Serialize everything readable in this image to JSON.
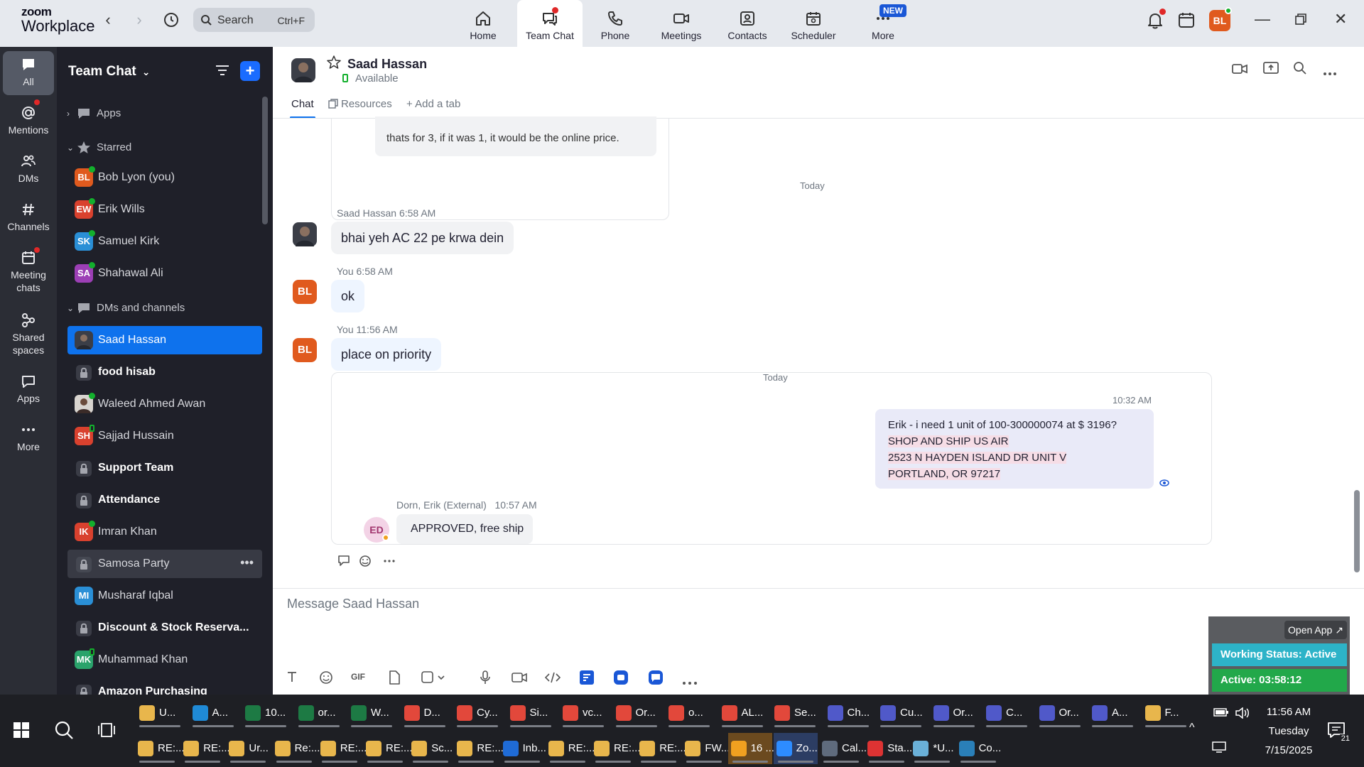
{
  "app": {
    "brand_top": "zoom",
    "brand_bottom": "Workplace",
    "search_label": "Search",
    "search_shortcut": "Ctrl+F",
    "nav_tabs": [
      {
        "label": "Home",
        "icon": "home-icon"
      },
      {
        "label": "Team Chat",
        "icon": "chat-icon",
        "active": true
      },
      {
        "label": "Phone",
        "icon": "phone-icon"
      },
      {
        "label": "Meetings",
        "icon": "video-icon"
      },
      {
        "label": "Contacts",
        "icon": "contacts-icon"
      },
      {
        "label": "Scheduler",
        "icon": "calendar-icon"
      },
      {
        "label": "More",
        "icon": "more-icon"
      }
    ],
    "new_badge": "NEW",
    "user_initials": "BL",
    "accent_color": "#0e72ed"
  },
  "rail": {
    "items": [
      {
        "label": "All",
        "icon": "chat-bubble-icon"
      },
      {
        "label": "Mentions",
        "icon": "at-icon"
      },
      {
        "label": "DMs",
        "icon": "people-icon"
      },
      {
        "label": "Channels",
        "icon": "hash-icon"
      },
      {
        "label": "Meeting\nchats",
        "icon": "calendar-chat-icon"
      },
      {
        "label": "Shared\nspaces",
        "icon": "shared-icon"
      },
      {
        "label": "Apps",
        "icon": "apps-icon"
      },
      {
        "label": "More",
        "icon": "ellipsis-icon"
      }
    ]
  },
  "sidebar": {
    "title": "Team Chat",
    "sections": {
      "apps": "Apps",
      "starred": "Starred",
      "dms": "DMs and channels"
    },
    "starred": [
      {
        "initials": "BL",
        "name": "Bob Lyon (you)",
        "color": "#e05a1e"
      },
      {
        "initials": "EW",
        "name": "Erik Wills",
        "color": "#d9412e"
      },
      {
        "initials": "SK",
        "name": "Samuel Kirk",
        "color": "#2a8fd6"
      },
      {
        "initials": "SA",
        "name": "Shahawal Ali",
        "color": "#9c3fb5"
      }
    ],
    "dms": [
      {
        "name": "Saad Hassan",
        "type": "photo",
        "selected": true
      },
      {
        "name": "food hisab",
        "type": "lock",
        "bold": true
      },
      {
        "name": "Waleed Ahmed Awan",
        "type": "photo"
      },
      {
        "initials": "SH",
        "name": "Sajjad Hussain",
        "color": "#d9412e"
      },
      {
        "name": "Support Team",
        "type": "lock",
        "bold": true
      },
      {
        "name": "Attendance",
        "type": "lock",
        "bold": true
      },
      {
        "initials": "IK",
        "name": "Imran Khan",
        "color": "#d9412e"
      },
      {
        "name": "Samosa Party",
        "type": "lock",
        "hover": true
      },
      {
        "initials": "MI",
        "name": "Musharaf Iqbal",
        "color": "#2a8fd6"
      },
      {
        "name": "Discount & Stock Reserva...",
        "type": "lock",
        "bold": true
      },
      {
        "initials": "MK",
        "name": "Muhammad Khan",
        "color": "#2aa36b"
      },
      {
        "name": "Amazon Purchasing",
        "type": "lock",
        "bold": true
      }
    ]
  },
  "chat": {
    "contact_name": "Saad Hassan",
    "status": "Available",
    "tabs": [
      "Chat",
      "Resources",
      "+ Add a tab"
    ],
    "quoted_text": "thats for 3, if it was 1, it would be the online price.",
    "day_sep_1": "Today",
    "day_sep_2": "Today",
    "messages": [
      {
        "sender": "Saad Hassan",
        "time": "6:58 AM",
        "text": "bhai yeh AC 22 pe krwa dein"
      },
      {
        "sender": "You",
        "time": "6:58 AM",
        "text": "ok"
      },
      {
        "sender": "You",
        "time": "11:56 AM",
        "text": "place on priority"
      }
    ],
    "thread": {
      "time": "10:32 AM",
      "lines": [
        "Erik  -  i need 1 unit of 100-300000074 at $ 3196?",
        "SHOP AND SHIP US AIR",
        "2523 N HAYDEN ISLAND DR UNIT V",
        "PORTLAND, OR 97217"
      ],
      "reply_initials": "ED",
      "reply_sender": "Dorn, Erik (External)",
      "reply_time": "10:57 AM",
      "reply_text": "APPROVED, free ship"
    },
    "composer_placeholder": "Message Saad Hassan"
  },
  "widget": {
    "open_app": "Open App ↗",
    "working_status": "Working Status: Active",
    "active_timer": "Active: 03:58:12"
  },
  "taskbar": {
    "row1": [
      {
        "label": "U...",
        "color": "#e8b64c"
      },
      {
        "label": "A...",
        "color": "#1f8ad6"
      },
      {
        "label": "10...",
        "color": "#1d7a44"
      },
      {
        "label": "or...",
        "color": "#1d7a44"
      },
      {
        "label": "W...",
        "color": "#1d7a44"
      },
      {
        "label": "D...",
        "color": "#e2483b"
      },
      {
        "label": "Cy...",
        "color": "#e2483b"
      },
      {
        "label": "Si...",
        "color": "#e2483b"
      },
      {
        "label": "vc...",
        "color": "#e2483b"
      },
      {
        "label": "Or...",
        "color": "#e2483b"
      },
      {
        "label": "o...",
        "color": "#e2483b"
      },
      {
        "label": "AL...",
        "color": "#e2483b"
      },
      {
        "label": "Se...",
        "color": "#e2483b"
      },
      {
        "label": "Ch...",
        "color": "#5059c9"
      },
      {
        "label": "Cu...",
        "color": "#5059c9"
      },
      {
        "label": "Or...",
        "color": "#5059c9"
      },
      {
        "label": "C...",
        "color": "#5059c9"
      },
      {
        "label": "Or...",
        "color": "#5059c9"
      },
      {
        "label": "A...",
        "color": "#5059c9"
      },
      {
        "label": "F...",
        "color": "#e8b64c"
      }
    ],
    "row2": [
      {
        "label": "RE:...",
        "color": "#e8b64c"
      },
      {
        "label": "RE:...",
        "color": "#e8b64c"
      },
      {
        "label": "Ur...",
        "color": "#e8b64c"
      },
      {
        "label": "Re:...",
        "color": "#e8b64c"
      },
      {
        "label": "RE:...",
        "color": "#e8b64c"
      },
      {
        "label": "RE:...",
        "color": "#e8b64c"
      },
      {
        "label": "Sc...",
        "color": "#e8b64c"
      },
      {
        "label": "RE:...",
        "color": "#e8b64c"
      },
      {
        "label": "Inb...",
        "color": "#1f6bd6"
      },
      {
        "label": "RE:...",
        "color": "#e8b64c"
      },
      {
        "label": "RE:...",
        "color": "#e8b64c"
      },
      {
        "label": "RE:...",
        "color": "#e8b64c"
      },
      {
        "label": "FW...",
        "color": "#e8b64c"
      },
      {
        "label": "16 ...",
        "color": "#f0a020"
      },
      {
        "label": "Zo...",
        "color": "#2d8cff"
      },
      {
        "label": "Cal...",
        "color": "#5f6b7d"
      },
      {
        "label": "Sta...",
        "color": "#d33"
      },
      {
        "label": "*U...",
        "color": "#6ab0d8"
      },
      {
        "label": "Co...",
        "color": "#2a7fb8"
      }
    ],
    "time": "11:56 AM",
    "day": "Tuesday",
    "date": "7/15/2025",
    "notif_count": "21"
  }
}
